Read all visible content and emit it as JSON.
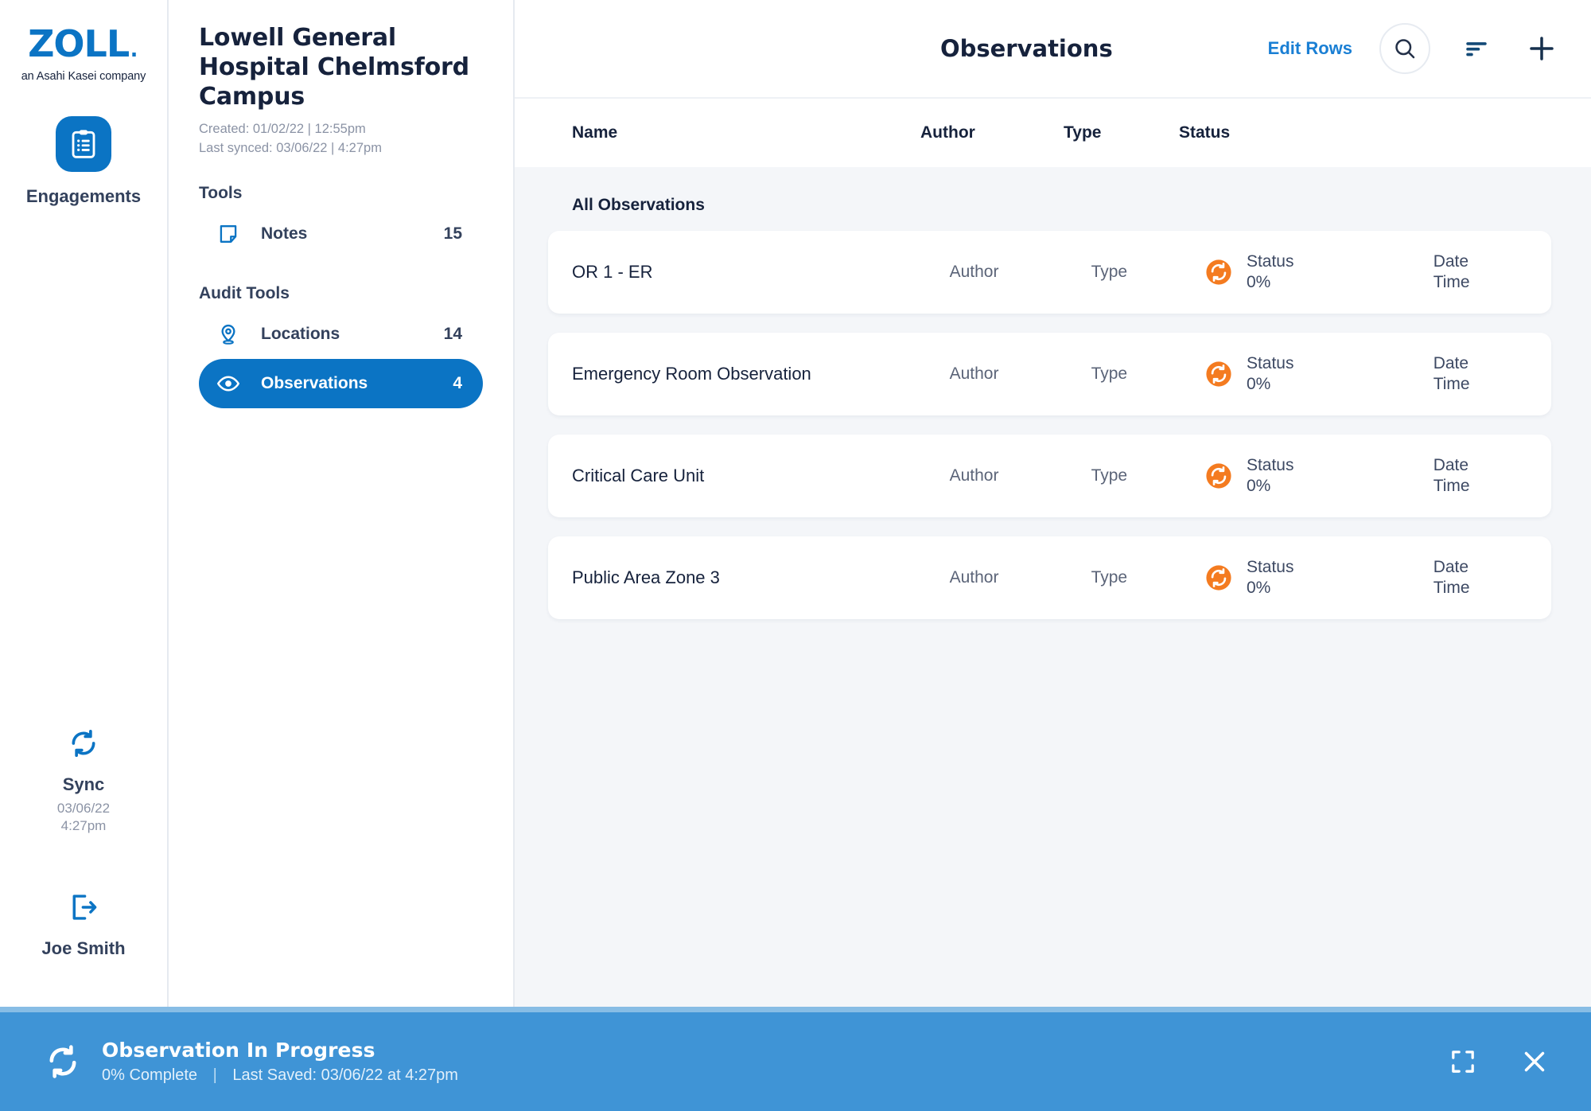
{
  "rail": {
    "logo_word": "ZOLL",
    "logo_tagline": "an Asahi Kasei company",
    "engagements_label": "Engagements",
    "sync_label": "Sync",
    "sync_date": "03/06/22",
    "sync_time": "4:27pm",
    "user_name": "Joe Smith",
    "accent_blue": "#0b74c4"
  },
  "panel": {
    "title": "Lowell General Hospital Chelmsford Campus",
    "created": "Created: 01/02/22 | 12:55pm",
    "last_synced": "Last synced: 03/06/22 | 4:27pm",
    "groups": [
      {
        "label": "Tools",
        "items": [
          {
            "label": "Notes",
            "count": "15",
            "icon": "note-icon",
            "active": false
          }
        ]
      },
      {
        "label": "Audit Tools",
        "items": [
          {
            "label": "Locations",
            "count": "14",
            "icon": "map-pin-icon",
            "active": false
          },
          {
            "label": "Observations",
            "count": "4",
            "icon": "eye-icon",
            "active": true
          }
        ]
      }
    ]
  },
  "topbar": {
    "title": "Observations",
    "edit_rows_label": "Edit Rows",
    "edit_rows_color": "#1a7fd4",
    "icons": [
      "search-icon",
      "sort-icon",
      "plus-icon"
    ]
  },
  "table": {
    "headers": {
      "name": "Name",
      "author": "Author",
      "type": "Type",
      "status": "Status"
    },
    "section_label": "All Observations",
    "rows": [
      {
        "name": "OR 1 - ER",
        "author": "Author",
        "type": "Type",
        "status_label": "Status",
        "status_percent": "0%",
        "status_color": "#f47b20",
        "date": "Date",
        "time": "Time"
      },
      {
        "name": "Emergency Room Observation",
        "author": "Author",
        "type": "Type",
        "status_label": "Status",
        "status_percent": "0%",
        "status_color": "#f47b20",
        "date": "Date",
        "time": "Time"
      },
      {
        "name": "Critical Care Unit",
        "author": "Author",
        "type": "Type",
        "status_label": "Status",
        "status_percent": "0%",
        "status_color": "#f47b20",
        "date": "Date",
        "time": "Time"
      },
      {
        "name": "Public Area Zone 3",
        "author": "Author",
        "type": "Type",
        "status_label": "Status",
        "status_percent": "0%",
        "status_color": "#f47b20",
        "date": "Date",
        "time": "Time"
      }
    ]
  },
  "banner": {
    "title": "Observation In Progress",
    "progress": "0% Complete",
    "separator": "|",
    "last_saved": "Last Saved: 03/06/22 at 4:27pm",
    "background": "#3f94d6",
    "expand_icon": "expand-icon",
    "close_icon": "close-icon"
  }
}
